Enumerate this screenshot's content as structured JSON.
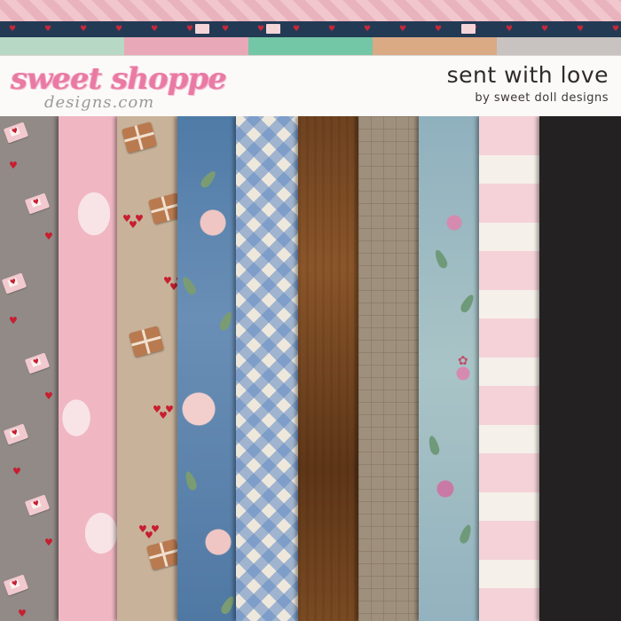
{
  "kit": {
    "title": "sent with love",
    "byline": "by sweet doll designs"
  },
  "brand": {
    "logo_line1": "sweet shoppe",
    "logo_line2": "designs.com",
    "logo_color": "#e97aa4"
  },
  "header_strips": {
    "colors": [
      "#b7d8c4",
      "#e9a8b8",
      "#73c6a6",
      "#d9aa84",
      "#c8c3c0"
    ]
  },
  "papers": [
    {
      "name": "gray-envelopes",
      "color": "#918a86"
    },
    {
      "name": "pink-clouds",
      "color": "#f0b7c3"
    },
    {
      "name": "kraft-parcels",
      "color": "#c8b29a"
    },
    {
      "name": "blue-floral",
      "color": "#4f7ba7"
    },
    {
      "name": "blue-gingham",
      "color": "#618ac4"
    },
    {
      "name": "brown-wood",
      "color": "#7a4a22"
    },
    {
      "name": "tan-grid",
      "color": "#9f907d"
    },
    {
      "name": "botanical",
      "color": "#a9c4c6"
    },
    {
      "name": "pink-stripe",
      "color": "#f4d2d8"
    },
    {
      "name": "black-solid",
      "color": "#232121"
    }
  ]
}
